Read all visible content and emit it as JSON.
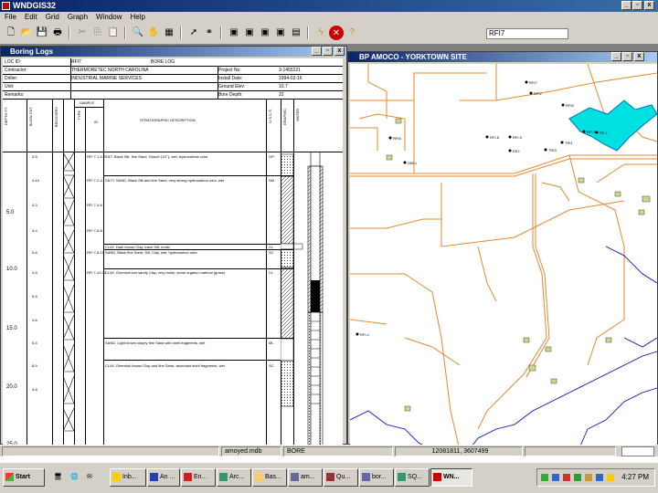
{
  "app": {
    "title": "WNDGIS32"
  },
  "menu": [
    "File",
    "Edit",
    "Grid",
    "Graph",
    "Window",
    "Help"
  ],
  "toolbar": {
    "buttons": [
      "new-icon",
      "open-icon",
      "save-icon",
      "print-icon",
      "cut-icon",
      "copy-icon",
      "paste-icon",
      "zoom-icon",
      "pan-icon",
      "layer-icon",
      "pointer-icon",
      "binoculars-icon",
      "view1-icon",
      "view2-icon",
      "view3-icon",
      "view4-icon",
      "chart-icon",
      "lightning-icon",
      "stop-icon",
      "help-icon"
    ],
    "combo_value": "RFI7"
  },
  "boring_log": {
    "window_title": "Boring Logs",
    "header": {
      "locid_label": "LOC ID:",
      "locid_value": "RFI7",
      "log_type": "BORE LOG",
      "contractor_label": "Contractor:",
      "contractor_value": "THERMORETEC NORTH CAROLINA",
      "driller_label": "Driller:",
      "driller_value": "INDUSTRIAL MARINE SERVICES",
      "unit_label": "Unit:",
      "remarks_label": "Remarks:",
      "project_label": "Project No:",
      "project_value": "3-1455221",
      "install_label": "Install Date:",
      "install_value": "1994-02-16",
      "ground_label": "Ground Elev:",
      "ground_value": "10.7",
      "depth_label": "Bore Depth:",
      "depth_value": "22"
    },
    "columns": {
      "depth": "DEPTH FT.",
      "blow": "BLOW CNT",
      "recovery": "RECOVERY",
      "sample": "SAMPLE",
      "type": "TYPE",
      "id": "ID",
      "description": "STRATIGRAPHIC DESCRIPTION",
      "uscs": "U.S.C.S.",
      "graphic": "GRAPHIC",
      "water": "WATER"
    },
    "depth_labels": [
      "5.0",
      "10.0",
      "15.0",
      "20.0",
      "25.0"
    ],
    "rows": [
      {
        "blow": "3-5",
        "id": "RFI 7-1-0-2",
        "desc": "SILT, Black Silt, fine Sand, Gravel (1/2\"), wet, hydrocarbon odor",
        "uscs": "GP"
      },
      {
        "blow": "4-10",
        "id": "RFI 7-2-4",
        "desc": "SILTY SAND, Black Silt and fine Sand, very strong hydrocarbon odor, wet",
        "uscs": "SM"
      },
      {
        "blow": "4-3",
        "id": "RFI 7-4-6",
        "desc": "",
        "uscs": ""
      },
      {
        "blow": "3-4",
        "id": "RFI 7-6-8",
        "desc": "",
        "uscs": ""
      },
      {
        "blow": "",
        "id": "",
        "desc": "CLAY, Dark brown Clay, trace Silt, moist",
        "uscs": "CL"
      },
      {
        "blow": "3-6",
        "id": "RFI 7-8-10",
        "desc": "SAND, Black fine Sand, Silt, Clay, wet, hydrocarbon odor",
        "uscs": "SC"
      },
      {
        "blow": "4-5",
        "id": "RFI 7-10-12",
        "desc": "CLAY, Greenish-tan sandy Clay, very moist, some organic material (grass)",
        "uscs": "CL"
      },
      {
        "blow": "5-5",
        "id": "",
        "desc": "",
        "uscs": ""
      },
      {
        "blow": "3-6",
        "id": "",
        "desc": "",
        "uscs": ""
      },
      {
        "blow": "5-4",
        "id": "",
        "desc": "SAND, Light brown clayey fine Sand with shell fragments, wet",
        "uscs": "ML"
      },
      {
        "blow": "8-9",
        "id": "",
        "desc": "CLAY, Greenish-brown Clay and fine Sand, abundant shell fragments, wet",
        "uscs": "SC"
      },
      {
        "blow": "4-8",
        "id": "",
        "desc": "",
        "uscs": ""
      }
    ]
  },
  "map": {
    "window_title": "BP AMOCO - YORKTOWN SITE",
    "labels": [
      "RFI7",
      "RFI2",
      "RFI5",
      "RFI6",
      "RFI-5",
      "RFI-8",
      "RFI-9",
      "DW-1",
      "TRI1",
      "TRI3",
      "EE2",
      "RFI-1",
      "PZ-1"
    ]
  },
  "statusbar": {
    "db": "amoyed.mdb",
    "mode": "BORE",
    "coords": "12081811, 3607499"
  },
  "taskbar": {
    "start": "Start",
    "buttons": [
      "Inb...",
      "An ...",
      "En...",
      "Arc...",
      "Bas...",
      "am...",
      "Qu...",
      "bor...",
      "SQ...",
      "WN..."
    ],
    "clock": "4:27 PM"
  }
}
